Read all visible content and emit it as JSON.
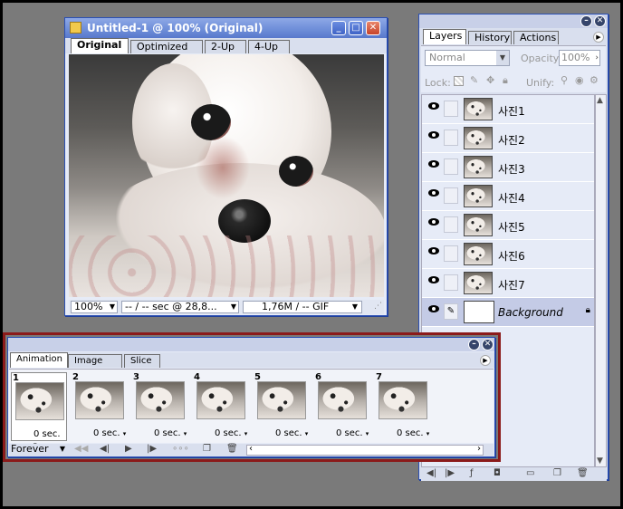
{
  "document_window": {
    "title": "Untitled-1 @ 100% (Original)",
    "tabs": [
      "Original",
      "Optimized",
      "2-Up",
      "4-Up"
    ],
    "status": {
      "zoom": "100%",
      "timing": "-- / -- sec @ 28,8...",
      "size": "1,76M / -- GIF"
    }
  },
  "layers_panel": {
    "tabs": [
      "Layers",
      "History",
      "Actions"
    ],
    "blend_mode": "Normal",
    "opacity_label": "Opacity:",
    "opacity_value": "100%",
    "lock_label": "Lock:",
    "unify_label": "Unify:",
    "layers": [
      {
        "name": "사진1",
        "italic": false
      },
      {
        "name": "사진2",
        "italic": false
      },
      {
        "name": "사진3",
        "italic": false
      },
      {
        "name": "사진4",
        "italic": false
      },
      {
        "name": "사진5",
        "italic": false
      },
      {
        "name": "사진6",
        "italic": false
      },
      {
        "name": "사진7",
        "italic": false
      },
      {
        "name": "Background",
        "italic": true
      }
    ]
  },
  "animation_panel": {
    "tabs": [
      "Animation",
      "Image Map",
      "Slice"
    ],
    "frames": [
      {
        "number": "1",
        "delay": "0 sec."
      },
      {
        "number": "2",
        "delay": "0 sec."
      },
      {
        "number": "3",
        "delay": "0 sec."
      },
      {
        "number": "4",
        "delay": "0 sec."
      },
      {
        "number": "5",
        "delay": "0 sec."
      },
      {
        "number": "6",
        "delay": "0 sec."
      },
      {
        "number": "7",
        "delay": "0 sec."
      }
    ],
    "loop": "Forever"
  },
  "colors": {
    "highlight_border": "#8b1a1a",
    "titlebar": "#6f8fd9",
    "selection": "#c4cbe6"
  }
}
